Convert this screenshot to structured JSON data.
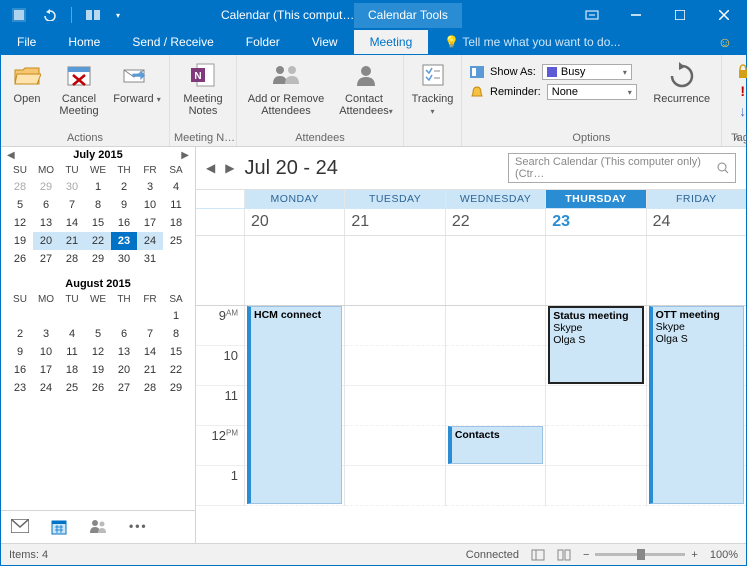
{
  "titlebar": {
    "title": "Calendar (This comput…",
    "tool_tab": "Calendar Tools"
  },
  "tabs": {
    "file": "File",
    "home": "Home",
    "sendreceive": "Send / Receive",
    "folder": "Folder",
    "view": "View",
    "meeting": "Meeting",
    "tell_me": "Tell me what you want to do..."
  },
  "ribbon": {
    "open": "Open",
    "cancel_meeting": "Cancel\nMeeting",
    "forward": "Forward",
    "actions": "Actions",
    "meeting_notes": "Meeting\nNotes",
    "meeting_n": "Meeting N…",
    "add_remove": "Add or Remove\nAttendees",
    "contact_attendees": "Contact\nAttendees",
    "attendees": "Attendees",
    "tracking": "Tracking",
    "show_as": "Show As:",
    "show_as_val": "Busy",
    "reminder": "Reminder:",
    "reminder_val": "None",
    "recurrence": "Recurrence",
    "options": "Options",
    "tags": "Tags"
  },
  "minical1": {
    "title": "July 2015",
    "dow": [
      "SU",
      "MO",
      "TU",
      "WE",
      "TH",
      "FR",
      "SA"
    ],
    "rows": [
      [
        {
          "v": "28",
          "dim": true
        },
        {
          "v": "29",
          "dim": true
        },
        {
          "v": "30",
          "dim": true
        },
        {
          "v": "1"
        },
        {
          "v": "2"
        },
        {
          "v": "3"
        },
        {
          "v": "4"
        }
      ],
      [
        {
          "v": "5"
        },
        {
          "v": "6"
        },
        {
          "v": "7"
        },
        {
          "v": "8"
        },
        {
          "v": "9"
        },
        {
          "v": "10"
        },
        {
          "v": "11"
        }
      ],
      [
        {
          "v": "12"
        },
        {
          "v": "13"
        },
        {
          "v": "14"
        },
        {
          "v": "15"
        },
        {
          "v": "16"
        },
        {
          "v": "17"
        },
        {
          "v": "18"
        }
      ],
      [
        {
          "v": "19"
        },
        {
          "v": "20",
          "sel": true
        },
        {
          "v": "21",
          "sel": true
        },
        {
          "v": "22",
          "sel": true
        },
        {
          "v": "23",
          "today": true
        },
        {
          "v": "24",
          "sel": true
        },
        {
          "v": "25"
        }
      ],
      [
        {
          "v": "26"
        },
        {
          "v": "27"
        },
        {
          "v": "28"
        },
        {
          "v": "29"
        },
        {
          "v": "30"
        },
        {
          "v": "31"
        },
        {
          "v": ""
        }
      ]
    ]
  },
  "minical2": {
    "title": "August 2015",
    "dow": [
      "SU",
      "MO",
      "TU",
      "WE",
      "TH",
      "FR",
      "SA"
    ],
    "rows": [
      [
        {
          "v": ""
        },
        {
          "v": ""
        },
        {
          "v": ""
        },
        {
          "v": ""
        },
        {
          "v": ""
        },
        {
          "v": ""
        },
        {
          "v": "1"
        }
      ],
      [
        {
          "v": "2"
        },
        {
          "v": "3"
        },
        {
          "v": "4"
        },
        {
          "v": "5"
        },
        {
          "v": "6"
        },
        {
          "v": "7"
        },
        {
          "v": "8"
        }
      ],
      [
        {
          "v": "9"
        },
        {
          "v": "10"
        },
        {
          "v": "11"
        },
        {
          "v": "12"
        },
        {
          "v": "13"
        },
        {
          "v": "14"
        },
        {
          "v": "15"
        }
      ],
      [
        {
          "v": "16"
        },
        {
          "v": "17"
        },
        {
          "v": "18"
        },
        {
          "v": "19"
        },
        {
          "v": "20"
        },
        {
          "v": "21"
        },
        {
          "v": "22"
        }
      ],
      [
        {
          "v": "23"
        },
        {
          "v": "24"
        },
        {
          "v": "25"
        },
        {
          "v": "26"
        },
        {
          "v": "27"
        },
        {
          "v": "28"
        },
        {
          "v": "29"
        }
      ]
    ]
  },
  "calendar": {
    "range": "Jul 20 - 24",
    "search_placeholder": "Search Calendar (This computer only) (Ctr…",
    "days": [
      "MONDAY",
      "TUESDAY",
      "WEDNESDAY",
      "THURSDAY",
      "FRIDAY"
    ],
    "dates": [
      "20",
      "21",
      "22",
      "23",
      "24"
    ],
    "today_index": 3,
    "hours": [
      {
        "h": "9",
        "suffix": "AM"
      },
      {
        "h": "10",
        "suffix": ""
      },
      {
        "h": "11",
        "suffix": ""
      },
      {
        "h": "12",
        "suffix": "PM"
      },
      {
        "h": "1",
        "suffix": ""
      }
    ],
    "appts": {
      "hcm": {
        "title": "HCM connect"
      },
      "status": {
        "title": "Status meeting",
        "loc": "Skype",
        "who": "Olga S"
      },
      "ott": {
        "title": "OTT meeting",
        "loc": "Skype",
        "who": "Olga S"
      },
      "contacts": {
        "title": "Contacts"
      }
    }
  },
  "status": {
    "items": "Items: 4",
    "connected": "Connected",
    "zoom": "100%"
  }
}
